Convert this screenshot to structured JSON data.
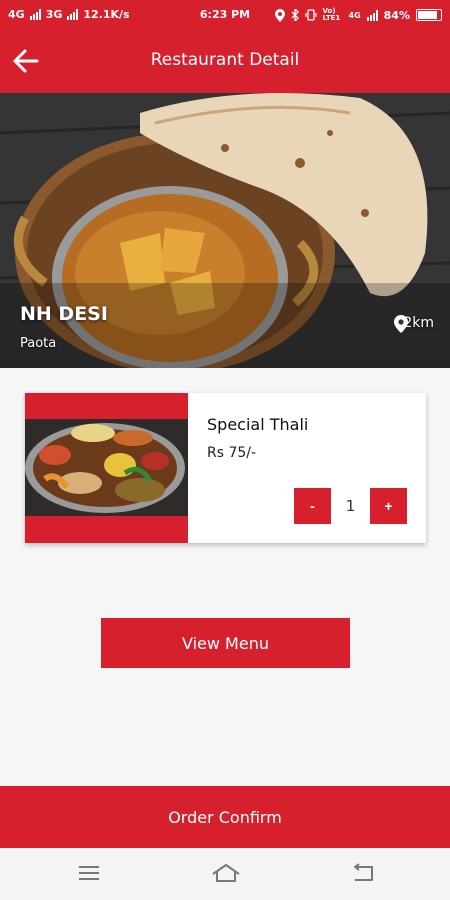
{
  "status": {
    "left": [
      "4G",
      "3G",
      "12.1K/s"
    ],
    "time": "6:23 PM",
    "right_label": "Vo) LTE1",
    "right_label2": "4G",
    "battery": "84%"
  },
  "header": {
    "title": "Restaurant Detail",
    "back_icon": "arrow-left-icon"
  },
  "restaurant": {
    "name": "NH DESI",
    "location": "Paota",
    "distance": "82km",
    "distance_icon": "location-pin-icon"
  },
  "item": {
    "name": "Special Thali",
    "price": "Rs 75/-",
    "quantity": "1",
    "minus_label": "-",
    "plus_label": "+"
  },
  "actions": {
    "view_menu": "View Menu",
    "order_confirm": "Order Confirm"
  },
  "navbar": {
    "icons": [
      "menu-icon",
      "home-icon",
      "back-icon"
    ]
  },
  "colors": {
    "accent": "#d7202e"
  }
}
